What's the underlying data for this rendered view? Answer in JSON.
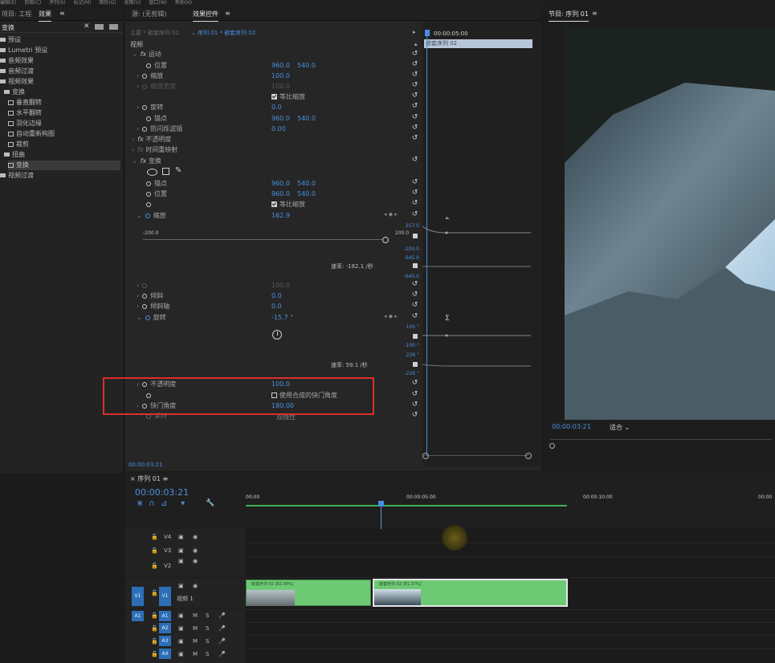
{
  "menubar": [
    "编辑(E)",
    "剪辑(C)",
    "序列(S)",
    "标记(M)",
    "图形(G)",
    "视图(V)",
    "窗口(W)",
    "帮助(H)"
  ],
  "left_panel": {
    "tabs": [
      "项目: 工程",
      "效果"
    ],
    "search_value": "变换",
    "tree": [
      {
        "label": "预设",
        "kind": "folder"
      },
      {
        "label": "Lumetri 预设",
        "kind": "folder"
      },
      {
        "label": "音频效果",
        "kind": "folder"
      },
      {
        "label": "音频过渡",
        "kind": "folder"
      },
      {
        "label": "视频效果",
        "kind": "folder"
      },
      {
        "label": "变换",
        "kind": "folder"
      },
      {
        "label": "垂直翻转",
        "kind": "effect"
      },
      {
        "label": "水平翻转",
        "kind": "effect"
      },
      {
        "label": "羽化边缘",
        "kind": "effect"
      },
      {
        "label": "自动重新构图",
        "kind": "effect"
      },
      {
        "label": "裁剪",
        "kind": "effect"
      },
      {
        "label": "扭曲",
        "kind": "folder"
      },
      {
        "label": "变换",
        "kind": "effect"
      },
      {
        "label": "视频过渡",
        "kind": "folder"
      }
    ]
  },
  "effect_controls": {
    "tabs": [
      "源: (无剪辑)",
      "效果控件"
    ],
    "breadcrumb": [
      "主要 * 嵌套序列 02",
      "序列 01 * 嵌套序列 02"
    ],
    "section": "视频",
    "mini_timecode": "00:00:05:00",
    "clip_label": "嵌套序列 02",
    "rows": [
      {
        "label": "运动",
        "fx": true
      },
      {
        "label": "位置",
        "v1": "960.0",
        "v2": "540.0"
      },
      {
        "label": "缩放",
        "v1": "100.0"
      },
      {
        "label": "缩放宽度",
        "v1": "100.0",
        "dim": true
      },
      {
        "label": "等比缩放",
        "checkbox": true
      },
      {
        "label": "旋转",
        "v1": "0.0"
      },
      {
        "label": "锚点",
        "v1": "960.0",
        "v2": "540.0"
      },
      {
        "label": "防闪烁滤镜",
        "v1": "0.00"
      },
      {
        "label": "不透明度",
        "fx": true
      },
      {
        "label": "时间重映射",
        "fx": true
      },
      {
        "label": "变换",
        "fx": true
      },
      {
        "label": "锚点",
        "v1": "960.0",
        "v2": "540.0"
      },
      {
        "label": "位置",
        "v1": "960.0",
        "v2": "540.0"
      },
      {
        "label": "等比缩放",
        "checkbox": true
      },
      {
        "label": "缩放",
        "v1": "162.9"
      }
    ],
    "scale_slider": {
      "min": "-200.0",
      "max": "200.0"
    },
    "scale_graph": {
      "top": "257.0",
      "a": "-200.0",
      "b": "645.0",
      "c": "-645.0",
      "velocity": "速率: -182.1 /秒"
    },
    "rows2": [
      {
        "label": "",
        "v1": "100.0",
        "dim": true
      },
      {
        "label": "倾斜",
        "v1": "0.0"
      },
      {
        "label": "倾斜轴",
        "v1": "0.0"
      },
      {
        "label": "旋转",
        "v1": "-15.7 °"
      }
    ],
    "rotation_graph": {
      "top": "100 °",
      "a": "-100 °",
      "b": "226 °",
      "c": "-226 °",
      "velocity": "速率: 59.1 /秒"
    },
    "rows3": [
      {
        "label": "不透明度",
        "v1": "100.0"
      },
      {
        "label": "使用合成的快门角度",
        "checkbox_off": true
      },
      {
        "label": "快门角度",
        "v1": "180.00"
      },
      {
        "label": "采样",
        "v1": "双线性"
      }
    ],
    "bottom_timecode": "00:00:03:21"
  },
  "program_monitor": {
    "title": "节目: 序列 01",
    "timecode": "00:00:03:21",
    "fit": "适合"
  },
  "timeline": {
    "tab": "序列 01",
    "timecode": "00:00:03:21",
    "ruler": [
      "00:00",
      "00:00:05:00",
      "00:00:10:00",
      "00:00"
    ],
    "video_tracks": [
      "V4",
      "V3",
      "V2",
      "V1"
    ],
    "v1_name": "视频 1",
    "audio_tracks": [
      "A1",
      "A2",
      "A3",
      "A4"
    ],
    "clips": [
      {
        "label": "嵌套序列 02 [82.08%]"
      },
      {
        "label": "嵌套序列 02 [81.37%]"
      }
    ],
    "track_letters": [
      "M",
      "S"
    ]
  },
  "colors": {
    "accent": "#4b8fe0",
    "clip": "#6dc974",
    "highlight": "#d9302c"
  }
}
